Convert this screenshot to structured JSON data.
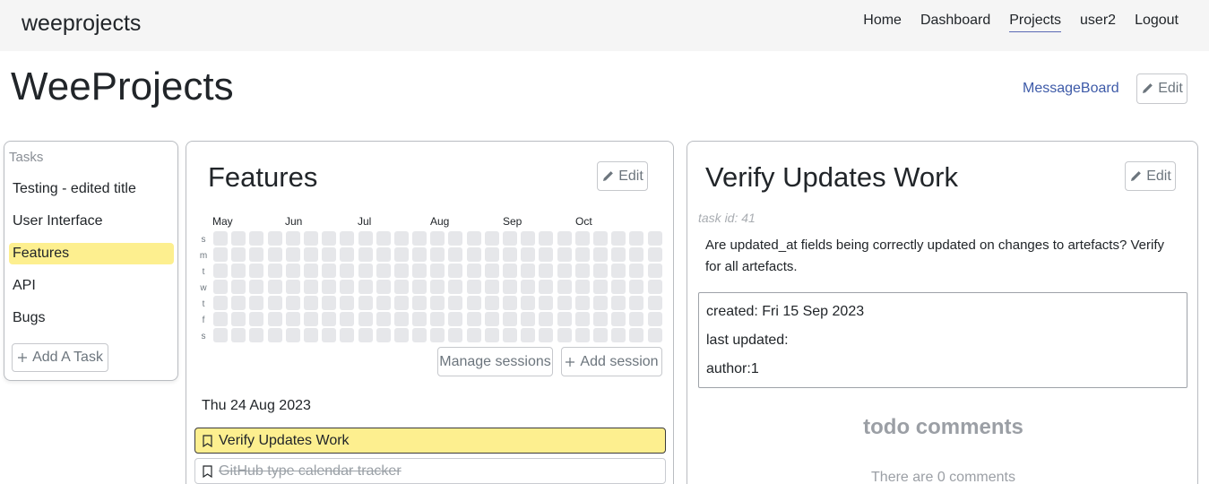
{
  "navbar": {
    "brand": "weeprojects",
    "links": [
      "Home",
      "Dashboard",
      "Projects",
      "user2",
      "Logout"
    ],
    "active": "Projects"
  },
  "page": {
    "title": "WeeProjects",
    "messageboard_link": "MessageBoard",
    "edit_label": "Edit"
  },
  "tasks": {
    "heading": "Tasks",
    "items": [
      "Testing - edited title",
      "User Interface",
      "Features",
      "API",
      "Bugs"
    ],
    "selected": "Features",
    "add_label": "Add A Task"
  },
  "features": {
    "title": "Features",
    "edit_label": "Edit",
    "calendar": {
      "months": [
        "May",
        "Jun",
        "Jul",
        "Aug",
        "Sep",
        "Oct"
      ],
      "day_labels": [
        "s",
        "m",
        "t",
        "w",
        "t",
        "f",
        "s"
      ]
    },
    "manage_label": "Manage sessions",
    "add_session_label": "Add session",
    "session_date": "Thu 24 Aug 2023",
    "sessions": [
      {
        "label": "Verify Updates Work",
        "state": "active"
      },
      {
        "label": "GitHub type calendar tracker",
        "state": "done"
      }
    ]
  },
  "detail": {
    "title": "Verify Updates Work",
    "edit_label": "Edit",
    "task_id": "task id: 41",
    "description": "Are updated_at fields being correctly updated on changes to artefacts? Verify for all artefacts.",
    "created": "created: Fri 15 Sep 2023",
    "last_updated": "last updated:",
    "author": "author:1",
    "comments_title": "todo comments",
    "comments_count": "There are 0 comments"
  },
  "colors": {
    "highlight": "#fdef8f",
    "link": "#3d5aa8",
    "calendar_cell": "#e6e7ea"
  }
}
